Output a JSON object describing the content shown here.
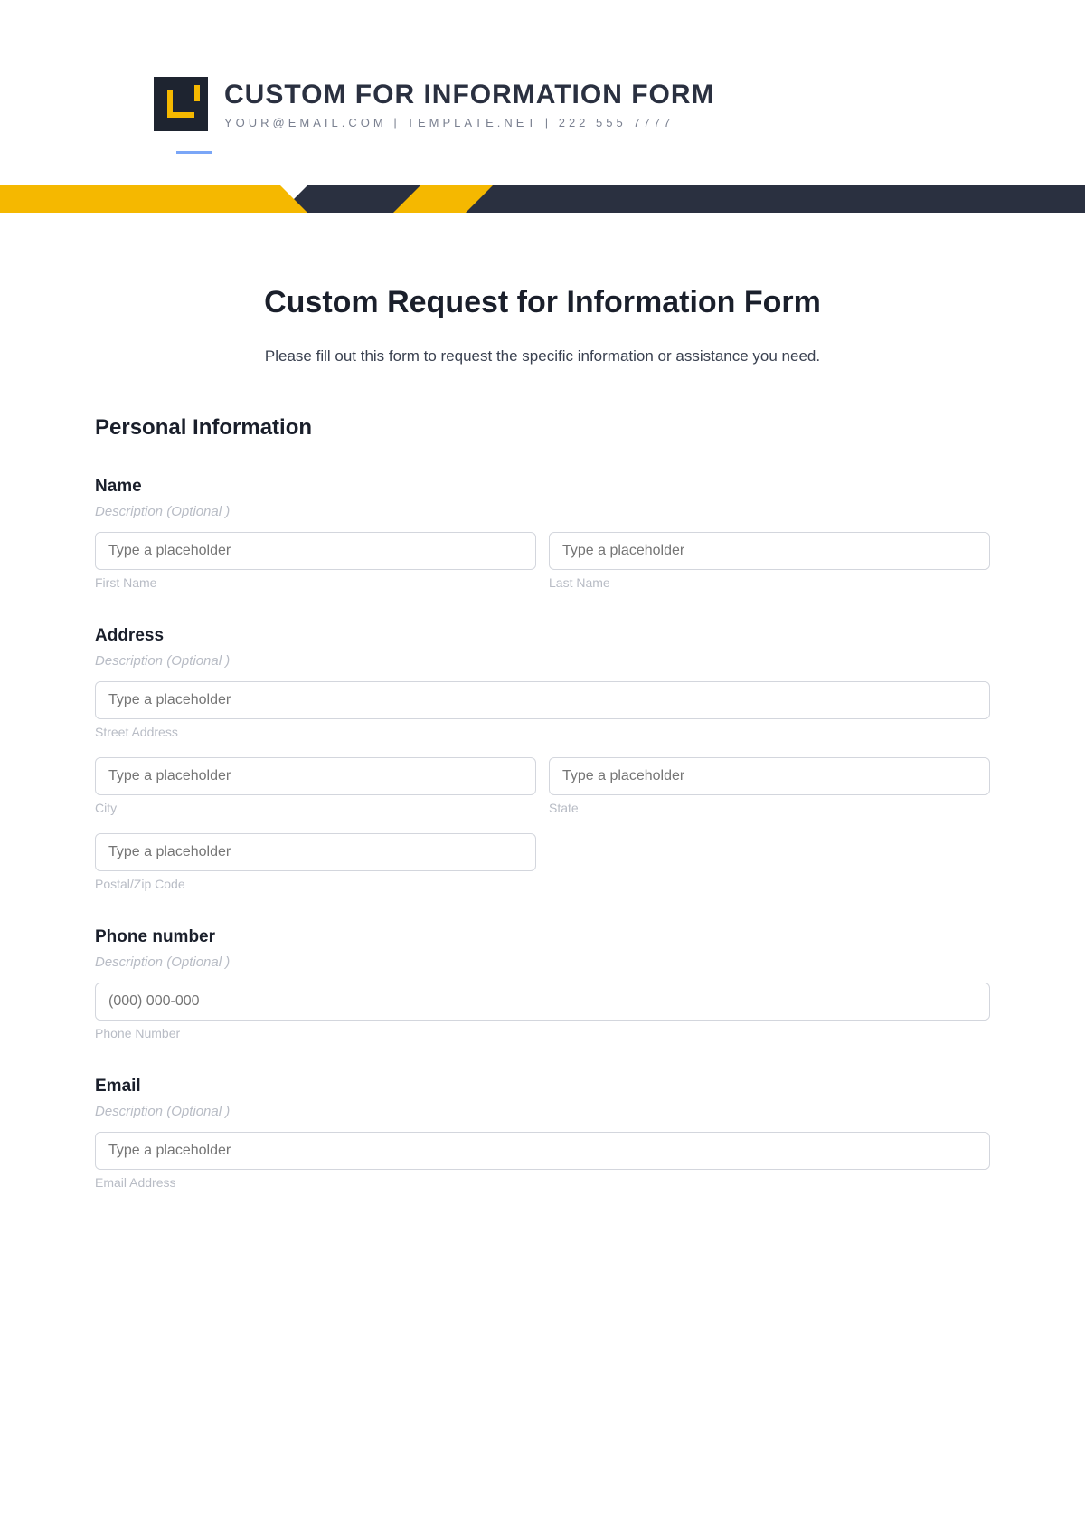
{
  "header": {
    "title": "CUSTOM FOR INFORMATION FORM",
    "subtitle": "YOUR@EMAIL.COM | TEMPLATE.NET | 222 555 7777"
  },
  "page": {
    "title": "Custom Request for Information Form",
    "description": "Please fill out this form to request the specific information or assistance you need."
  },
  "section_personal": "Personal Information",
  "name": {
    "label": "Name",
    "desc": "Description (Optional )",
    "first_placeholder": "Type a placeholder",
    "first_sub": "First Name",
    "last_placeholder": "Type a placeholder",
    "last_sub": "Last Name"
  },
  "address": {
    "label": "Address",
    "desc": "Description (Optional )",
    "street_placeholder": "Type a placeholder",
    "street_sub": "Street Address",
    "city_placeholder": "Type a placeholder",
    "city_sub": "City",
    "state_placeholder": "Type a placeholder",
    "state_sub": "State",
    "zip_placeholder": "Type a placeholder",
    "zip_sub": "Postal/Zip Code"
  },
  "phone": {
    "label": "Phone number",
    "desc": "Description (Optional )",
    "placeholder": "(000) 000-000",
    "sub": "Phone Number"
  },
  "email": {
    "label": "Email",
    "desc": "Description (Optional )",
    "placeholder": "Type a placeholder",
    "sub": "Email Address"
  }
}
